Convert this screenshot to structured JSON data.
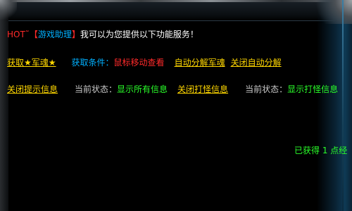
{
  "header": {
    "hot": "HOT˜",
    "bracket_open": "【",
    "helper_name": "游戏助理",
    "bracket_close": "】",
    "intro": "我可以为您提供以下功能服务！"
  },
  "row1": {
    "get_soul_link": "获取★军魂★",
    "condition_label": "获取条件：",
    "condition_value": "鼠标移动查看",
    "auto_decompose_link": "自动分解军魂",
    "close_auto_decompose_link": "关闭自动分解"
  },
  "row2": {
    "close_tips_link": "关闭提示信息",
    "state_label_1": "当前状态：",
    "state_value_1": "显示所有信息",
    "close_monster_info_link": "关闭打怪信息",
    "state_label_2": "当前状态：",
    "state_value_2": "显示打怪信息"
  },
  "footer": {
    "obtained_text": "已获得 1 点经"
  },
  "colors": {
    "background": "#000000",
    "hot_red": "#ff2a2a",
    "helper_blue": "#00b0ff",
    "link_yellow": "#ffd700",
    "status_green": "#2aff2a",
    "label_grey": "#c9c9c9"
  }
}
